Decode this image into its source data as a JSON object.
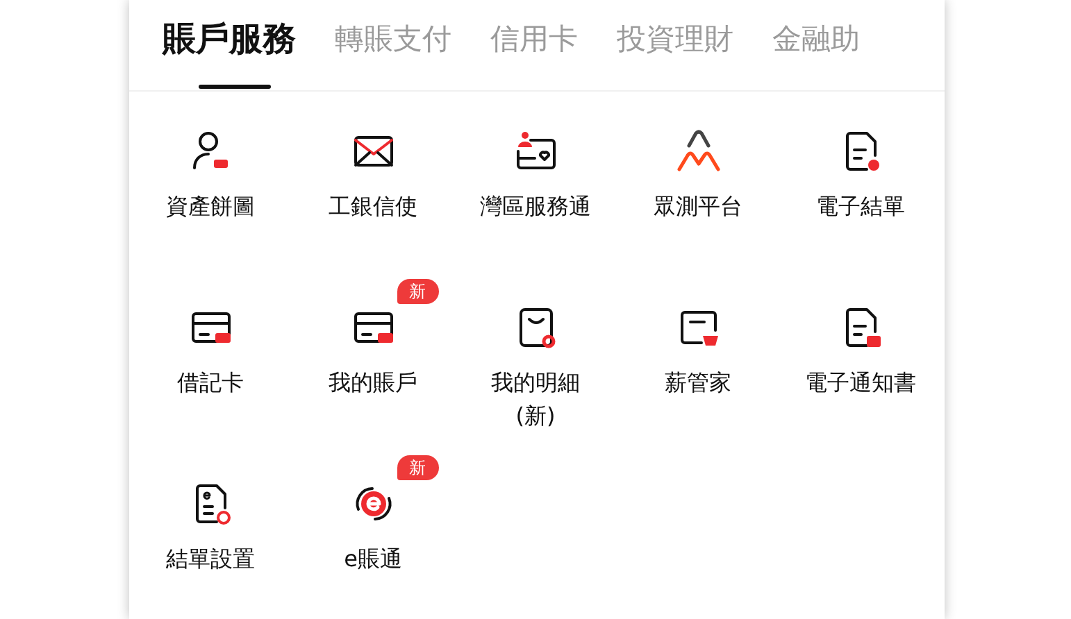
{
  "tabs": [
    {
      "label": "賬戶服務",
      "selected": true
    },
    {
      "label": "轉賬支付",
      "selected": false
    },
    {
      "label": "信用卡",
      "selected": false
    },
    {
      "label": "投資理財",
      "selected": false
    },
    {
      "label": "金融助",
      "selected": false
    }
  ],
  "services": [
    {
      "label": "資產餅圖"
    },
    {
      "label": "工銀信使"
    },
    {
      "label": "灣區服務通"
    },
    {
      "label": "眾測平台"
    },
    {
      "label": "電子結單"
    },
    {
      "label": "借記卡"
    },
    {
      "label": "我的賬戶",
      "badge": "新"
    },
    {
      "label": "我的明細\n(新)"
    },
    {
      "label": "薪管家"
    },
    {
      "label": "電子通知書"
    },
    {
      "label": "結單設置"
    },
    {
      "label": "e賬通",
      "badge": "新"
    }
  ]
}
